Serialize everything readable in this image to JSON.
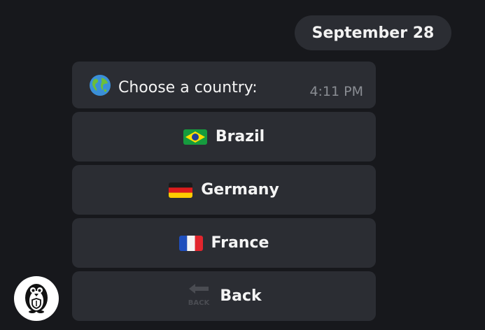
{
  "date_separator": "September 28",
  "message": {
    "text": "Choose a country:",
    "time": "4:11 PM",
    "icon": "globe-icon"
  },
  "keyboard": {
    "buttons": [
      {
        "label": "Brazil",
        "icon": "brazil-flag-icon"
      },
      {
        "label": "Germany",
        "icon": "germany-flag-icon"
      },
      {
        "label": "France",
        "icon": "france-flag-icon"
      },
      {
        "label": "Back",
        "icon": "back-arrow-icon"
      }
    ]
  },
  "back_icon_text": "BACK",
  "avatar": {
    "icon": "penguin-icon"
  },
  "colors": {
    "background": "#17181c",
    "bubble": "#2b2d33",
    "muted_text": "#8a8d93"
  }
}
